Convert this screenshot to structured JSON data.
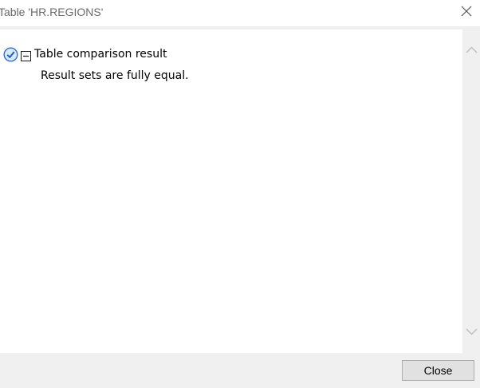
{
  "window": {
    "title": "Table 'HR.REGIONS'"
  },
  "tree": {
    "root": {
      "label": "Table comparison result",
      "status_icon": "check-circle-icon",
      "expander_icon": "collapse-minus-icon",
      "children": [
        "Result sets are fully equal."
      ]
    }
  },
  "footer": {
    "close_label": "Close"
  },
  "colors": {
    "check_accent": "#2b6fd6",
    "footer_bg": "#f0f0f0",
    "scrollbar_bg": "#f0f0f0",
    "button_bg": "#e1e1e1"
  }
}
